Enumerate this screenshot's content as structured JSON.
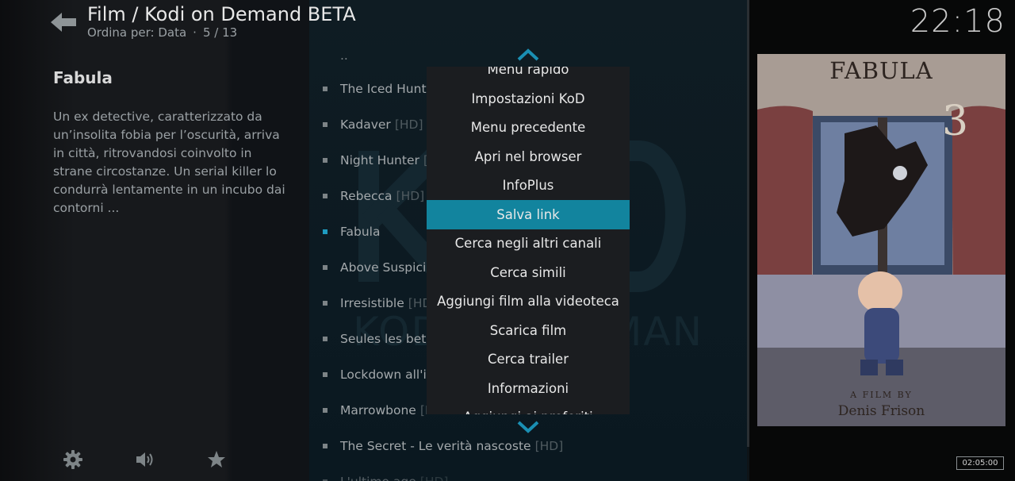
{
  "header": {
    "title": "Film / Kodi on Demand BETA",
    "sort_label": "Ordina per: Data",
    "separator": "·",
    "position": "5 / 13"
  },
  "clock": "22:18",
  "info": {
    "title": "Fabula",
    "plot": "Un ex detective, caratterizzato da un’insolita fobia per l’oscurità, arriva in città, ritrovandosi coinvolto in strane circostanze. Un serial killer lo condurrà lentamente in un incubo dai contorni ..."
  },
  "list": {
    "parent": "..",
    "items": [
      {
        "label": "The Iced Hunte",
        "tag": ""
      },
      {
        "label": "Kadaver",
        "tag": "[HD]"
      },
      {
        "label": "Night Hunter",
        "tag": "["
      },
      {
        "label": "Rebecca",
        "tag": "[HD]"
      },
      {
        "label": "Fabula",
        "tag": ""
      },
      {
        "label": "Above Suspicio",
        "tag": ""
      },
      {
        "label": "Irresistible",
        "tag": "[HD"
      },
      {
        "label": "Seules les bete",
        "tag": ""
      },
      {
        "label": "Lockdown all'i",
        "tag": ""
      },
      {
        "label": "Marrowbone",
        "tag": "[H"
      },
      {
        "label": "The Secret - Le verità nascoste",
        "tag": "[HD]"
      },
      {
        "label": "L'ultimo age",
        "tag": "[HD]"
      }
    ]
  },
  "context_menu": {
    "items": [
      "Menu rapido",
      "Impostazioni KoD",
      "Menu precedente",
      "Apri nel browser",
      "InfoPlus",
      "Salva link",
      "Cerca negli altri canali",
      "Cerca simili",
      "Aggiungi film alla videoteca",
      "Scarica film",
      "Cerca trailer",
      "Informazioni",
      "Aggiungi ai preferiti"
    ],
    "focused_index": 5
  },
  "watermark": {
    "big": "KoD",
    "small": "KODI ON DEMAND"
  },
  "poster": {
    "title": "FABULA",
    "number": "3",
    "credit_line1": "A FILM BY",
    "credit_line2": "Denis Frison"
  },
  "runtime": "02:05:00",
  "bottom_bar": [
    "settings-icon",
    "volume-icon",
    "favourites-icon"
  ],
  "colors": {
    "accent": "#12849e",
    "menu_bg": "#1b1d20",
    "bullet_active": "#1e9bc0"
  }
}
